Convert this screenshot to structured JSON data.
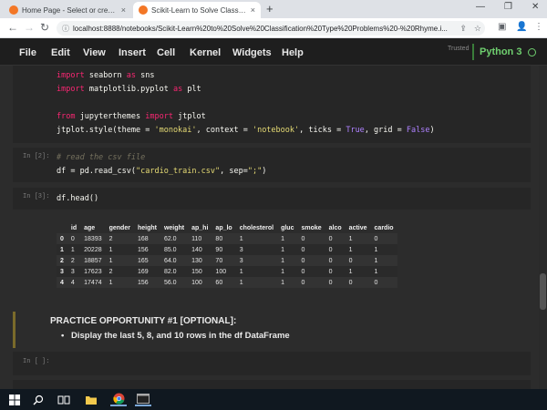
{
  "browser": {
    "tabs": [
      {
        "title": "Home Page - Select or create a n",
        "close": "×"
      },
      {
        "title": "Scikit-Learn to Solve Classificati",
        "close": "×"
      }
    ],
    "new_tab": "+",
    "window_controls": {
      "minimize": "—",
      "restore": "❐",
      "close": "✕"
    },
    "url": "localhost:8888/notebooks/Scikit-Learn%20to%20Solve%20Classification%20Type%20Problems%20-%20Rhyme.i..."
  },
  "jupyter": {
    "menu": [
      "File",
      "Edit",
      "View",
      "Insert",
      "Cell",
      "Kernel",
      "Widgets",
      "Help"
    ],
    "trusted": "Trusted",
    "kernel": "Python 3"
  },
  "cells": {
    "c1_prompt": "",
    "c2_prompt": "In [2]:",
    "c3_prompt": "In [3]:",
    "c4_prompt": "In [ ]:",
    "c2_comment": "# read the csv file",
    "c3_code": "df.head()"
  },
  "dataframe": {
    "columns": [
      "",
      "id",
      "age",
      "gender",
      "height",
      "weight",
      "ap_hi",
      "ap_lo",
      "cholesterol",
      "gluc",
      "smoke",
      "alco",
      "active",
      "cardio"
    ],
    "rows": [
      [
        "0",
        "0",
        "18393",
        "2",
        "168",
        "62.0",
        "110",
        "80",
        "1",
        "1",
        "0",
        "0",
        "1",
        "0"
      ],
      [
        "1",
        "1",
        "20228",
        "1",
        "156",
        "85.0",
        "140",
        "90",
        "3",
        "1",
        "0",
        "0",
        "1",
        "1"
      ],
      [
        "2",
        "2",
        "18857",
        "1",
        "165",
        "64.0",
        "130",
        "70",
        "3",
        "1",
        "0",
        "0",
        "0",
        "1"
      ],
      [
        "3",
        "3",
        "17623",
        "2",
        "169",
        "82.0",
        "150",
        "100",
        "1",
        "1",
        "0",
        "0",
        "1",
        "1"
      ],
      [
        "4",
        "4",
        "17474",
        "1",
        "156",
        "56.0",
        "100",
        "60",
        "1",
        "1",
        "0",
        "0",
        "0",
        "0"
      ]
    ]
  },
  "markdown": {
    "title": "PRACTICE OPPORTUNITY #1 [OPTIONAL]:",
    "bullet": "Display the last 5, 8, and 10 rows in the df DataFrame"
  },
  "colors": {
    "accent_green": "#6fcf6f",
    "chrome_blue": "#1a73e8",
    "bg_dark": "#1e1e1e",
    "monokai_pink": "#f92672",
    "monokai_yellow": "#e6db74",
    "monokai_purple": "#ae81ff"
  },
  "taskbar": {
    "icons": [
      "windows-icon",
      "search-icon",
      "task-view-icon",
      "file-explorer-icon",
      "store-icon",
      "chrome-icon",
      "terminal-icon"
    ]
  }
}
